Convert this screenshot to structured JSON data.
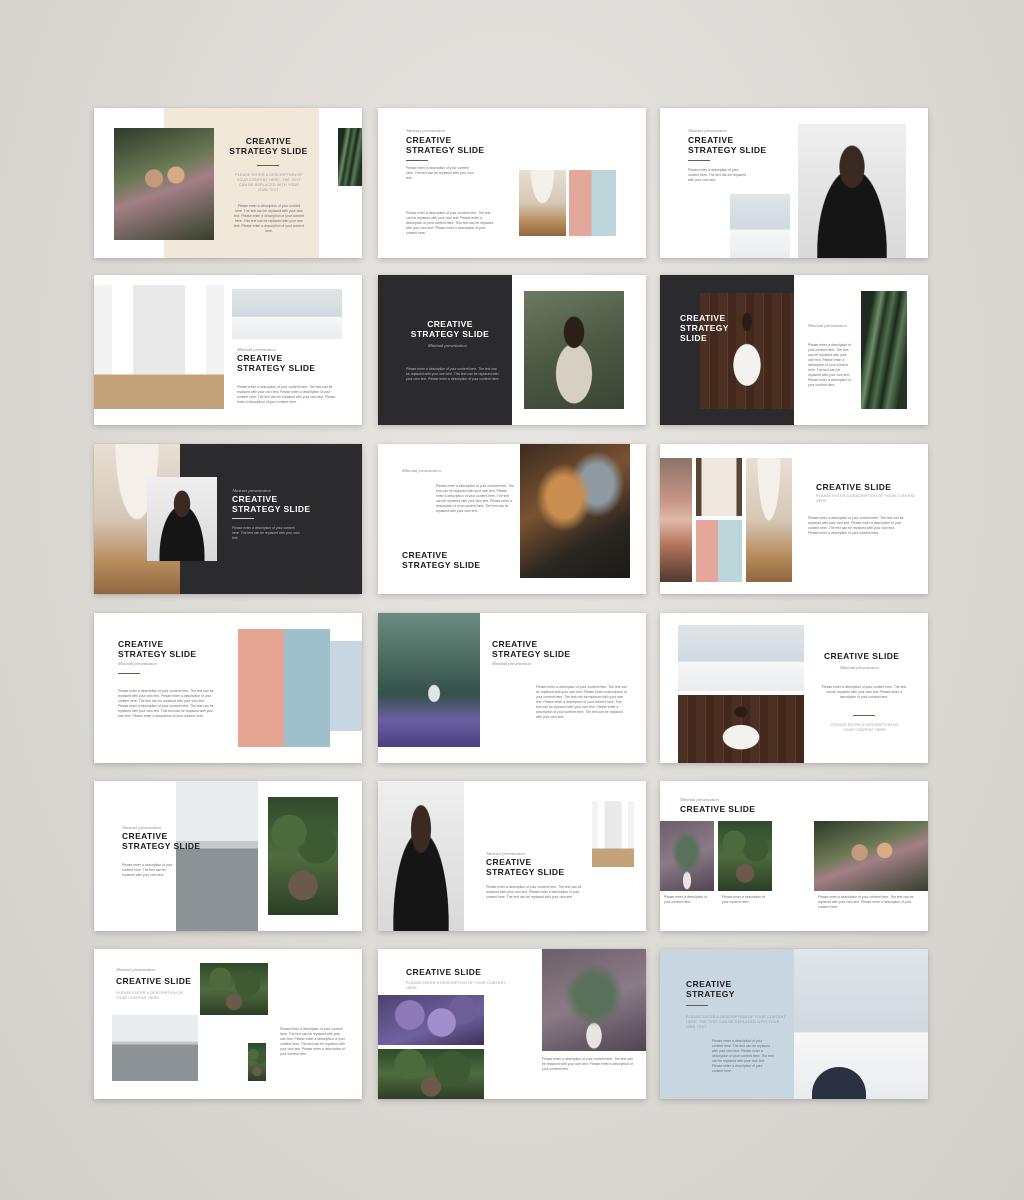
{
  "slides": {
    "s1": {
      "title": "CREATIVE\nSTRATEGY SLIDE",
      "caps": "Please enter a description of your content here. The text can be replaced with your own text.",
      "para": "Please enter a description of your content here. The text can be replaced with your own text. Please enter a description of your content here. This text can be replaced with your own text. Please enter a description of your content here."
    },
    "s2": {
      "sub": "Abstract presentation",
      "title": "CREATIVE\nSTRATEGY SLIDE",
      "para_top": "Please enter a description of your content here. The text can be replaced with your own text.",
      "para": "Please enter a description of your content here. The text can be replaced with your own text. Please enter a description of your content here. This text can be replaced with your own text. Please enter a description of your content here."
    },
    "s3": {
      "sub": "Abstract presentation",
      "title": "CREATIVE\nSTRATEGY SLIDE",
      "para": "Please enter a description of your content here. The text can be replaced with your own text."
    },
    "s4": {
      "sub": "Minimal presentation",
      "title": "CREATIVE\nSTRATEGY SLIDE",
      "para": "Please enter a description of your content here. The text can be replaced with your own text. Please enter a description of your content here. The text can be replaced with your own text. Please enter a description of your content here."
    },
    "s5": {
      "title": "CREATIVE\nSTRATEGY SLIDE",
      "sub": "Minimal presentation",
      "para": "Please enter a description of your content here. The text can be replaced with your own text. This text can be replaced with your own text. Please enter a description of your content here."
    },
    "s6": {
      "title": "CREATIVE\nSTRATEGY\nSLIDE",
      "sub": "Minimal presentation",
      "para": "Please enter a description of your content here. The text can be replaced with your own text. Please enter a description of your content here. The text can be replaced with your own text. Please enter a description of your content here."
    },
    "s7": {
      "sub": "Abstract presentation",
      "title": "CREATIVE\nSTRATEGY SLIDE",
      "para": "Please enter a description of your content here. The text can be replaced with your own text."
    },
    "s8": {
      "sub": "Minimal presentation",
      "title": "CREATIVE\nSTRATEGY SLIDE",
      "para": "Please enter a description of your content here. The text can be replaced with your own text. Please enter a description of your content here. The text can be replaced with your own text. Please enter a description of your content here. The text can be replaced with your own text."
    },
    "s9": {
      "title": "CREATIVE SLIDE",
      "caps": "Please enter a description of your content here.",
      "para": "Please enter a description of your content here. The text can be replaced with your own text. Please enter a description of your content here. The text can be replaced with your own text. Please enter a description of your content here."
    },
    "s10": {
      "title": "CREATIVE\nSTRATEGY SLIDE",
      "sub": "Minimal presentation",
      "para": "Please enter a description of your content here. The text can be replaced with your own text. Please enter a description of your content here. The text can be replaced with your own text. Please enter a description of your content here. The text can be replaced with your own text. This text can be replaced with your own text. Please enter a description of your content here."
    },
    "s11": {
      "title": "CREATIVE\nSTRATEGY SLIDE",
      "sub": "Minimal presentation",
      "para": "Please enter a description of your content here. The text can be replaced with your own text. Please enter a description of your content here. The text can be replaced with your own text. Please enter a description of your content here. This text can be replaced with your own text. Please enter a description of your content here. The text can be replaced with your own text."
    },
    "s12": {
      "title": "CREATIVE SLIDE",
      "sub": "Minimal presentation",
      "para": "Please enter a description of your content here. The text can be replaced with your own text. Please enter a description of your content here.",
      "caps": "Please enter a description of your content here."
    },
    "s13": {
      "sub": "Abstract presentation",
      "title": "CREATIVE\nSTRATEGY SLIDE",
      "para": "Please enter a description of your content here. The text can be replaced with your own text."
    },
    "s14": {
      "sub": "Abstract presentation",
      "title": "CREATIVE\nSTRATEGY SLIDE",
      "para": "Please enter a description of your content here. The text can be replaced with your own text. Please enter a description of your content here. The text can be replaced with your own text."
    },
    "s15": {
      "sub": "Minimal presentation",
      "title": "CREATIVE SLIDE",
      "para_a": "Please enter a description of your content here.",
      "para_b": "Please enter a description of your content here.",
      "para_c": "Please enter a description of your content here. The text can be replaced with your own text. Please enter a description of your content here."
    },
    "s16": {
      "sub": "Abstract presentation",
      "title": "CREATIVE SLIDE",
      "caps": "Please enter a description of your content here.",
      "para": "Please enter a description of your content here. The text can be replaced with your own text. Please enter a description of your content here. The text can be replaced with your own text. Please enter a description of your content here."
    },
    "s17": {
      "title": "CREATIVE SLIDE",
      "caps": "Please enter a description of your content here.",
      "para": "Please enter a description of your content here. The text can be replaced with your own text. Please enter a description of your content here."
    },
    "s18": {
      "title": "CREATIVE\nSTRATEGY",
      "caps": "Please enter a description of your content here. The text can be replaced with your own text.",
      "para": "Please enter a description of your content here. The text can be replaced with your own text. Please enter a description of your content here. The text can be replaced with your own text. Please enter a description of your content here."
    }
  },
  "colors": {
    "background": "#dcd8d4",
    "beige_panel": "#f2e8da",
    "dark_panel": "#2b2b2e",
    "blue_panel": "#c8d6e2",
    "accent_rule": "#6b5a45"
  }
}
